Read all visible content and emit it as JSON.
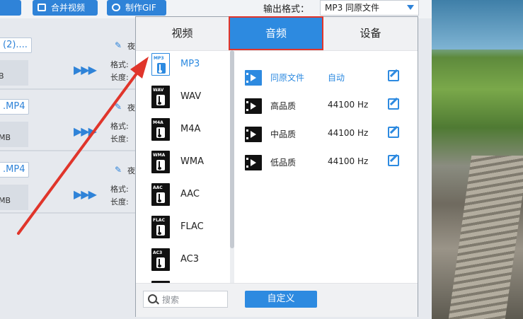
{
  "toolbar": {
    "buttons": [
      {
        "label": ""
      },
      {
        "label": "合并视频"
      },
      {
        "label": "制作GIF"
      }
    ],
    "output_format_label": "输出格式：",
    "output_format_value": "MP3  同原文件"
  },
  "files": [
    {
      "name": "(2)....",
      "size": "B",
      "format_label": "格式:",
      "duration_label": "长度:",
      "edit_text": "夜"
    },
    {
      "name": ".MP4",
      "size": "MB",
      "format_label": "格式:",
      "duration_label": "长度:",
      "edit_text": "夜"
    },
    {
      "name": ".MP4",
      "size": "MB",
      "format_label": "格式:",
      "duration_label": "长度:",
      "edit_text": "夜"
    }
  ],
  "panel": {
    "tabs": [
      {
        "label": "视频"
      },
      {
        "label": "音频"
      },
      {
        "label": "设备"
      }
    ],
    "active_tab": "音频",
    "formats": [
      {
        "tag": "MP3",
        "label": "MP3",
        "selected": true
      },
      {
        "tag": "WAV",
        "label": "WAV"
      },
      {
        "tag": "M4A",
        "label": "M4A"
      },
      {
        "tag": "WMA",
        "label": "WMA"
      },
      {
        "tag": "AAC",
        "label": "AAC"
      },
      {
        "tag": "FLAC",
        "label": "FLAC"
      },
      {
        "tag": "AC3",
        "label": "AC3"
      }
    ],
    "qualities": [
      {
        "name": "同原文件",
        "rate": "自动",
        "selected": true
      },
      {
        "name": "高品质",
        "rate": "44100 Hz"
      },
      {
        "name": "中品质",
        "rate": "44100 Hz"
      },
      {
        "name": "低品质",
        "rate": "44100 Hz"
      }
    ],
    "search_placeholder": "搜索",
    "custom_button": "自定义"
  },
  "colors": {
    "accent": "#2d8ae0",
    "highlight_outline": "#e0352b",
    "annotation_arrow": "#e0352b"
  }
}
